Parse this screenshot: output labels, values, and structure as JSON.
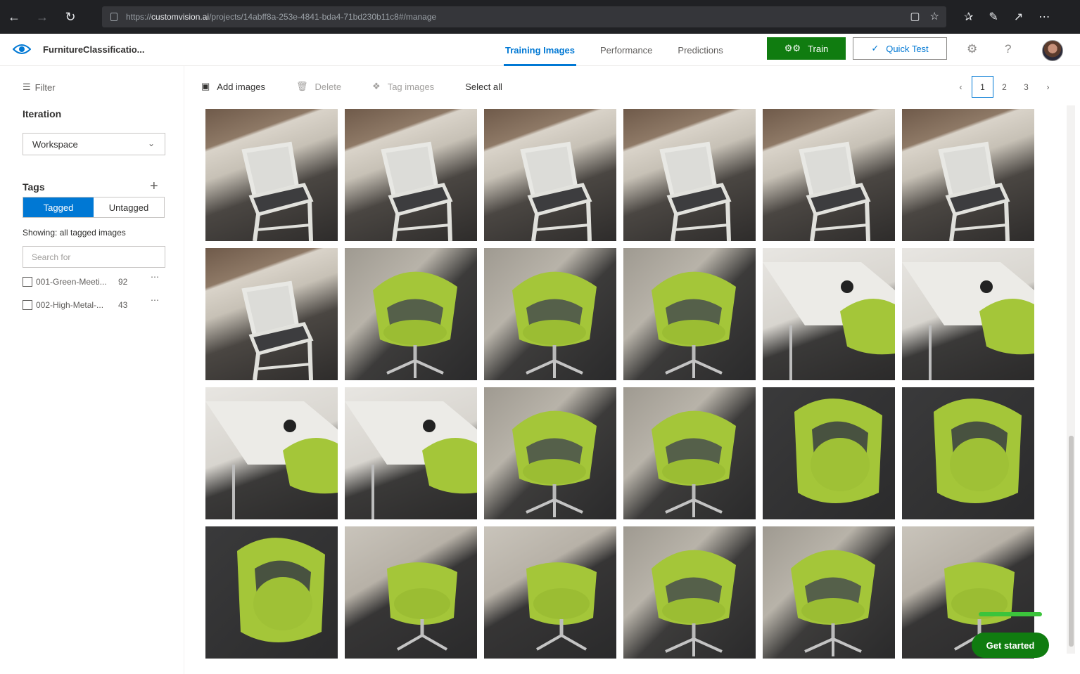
{
  "browser": {
    "url_prefix": "https://",
    "url_host": "customvision.ai",
    "url_path": "/projects/14abff8a-253e-4841-bda4-71bd230b11c8#/manage"
  },
  "header": {
    "project_name": "FurnitureClassificatio...",
    "tabs": [
      {
        "label": "Training Images",
        "active": true
      },
      {
        "label": "Performance",
        "active": false
      },
      {
        "label": "Predictions",
        "active": false
      }
    ],
    "train_label": "Train",
    "quick_test_label": "Quick Test"
  },
  "sidebar": {
    "filter_label": "Filter",
    "iteration_title": "Iteration",
    "iteration_value": "Workspace",
    "tags_title": "Tags",
    "tagged_label": "Tagged",
    "untagged_label": "Untagged",
    "showing_text": "Showing: all tagged images",
    "search_placeholder": "Search for",
    "tags": [
      {
        "name": "001-Green-Meeti...",
        "count": "92"
      },
      {
        "name": "002-High-Metal-...",
        "count": "43"
      }
    ]
  },
  "toolbar": {
    "add_images": "Add images",
    "delete": "Delete",
    "tag_images": "Tag images",
    "select_all": "Select all"
  },
  "pager": {
    "prev": "‹",
    "pages": [
      "1",
      "2",
      "3"
    ],
    "current": "1",
    "next": "›"
  },
  "images": [
    "stool",
    "stool",
    "stool",
    "stool",
    "stool",
    "stool",
    "stool",
    "green",
    "green",
    "green",
    "desk",
    "desk",
    "desk",
    "desk",
    "green",
    "green",
    "dark",
    "dark",
    "dark",
    "wall",
    "wall",
    "green",
    "green",
    "wall"
  ],
  "colors": {
    "accent": "#0078d4",
    "train_green": "#107c10",
    "chair_green": "#a4c639"
  },
  "get_started_label": "Get started"
}
